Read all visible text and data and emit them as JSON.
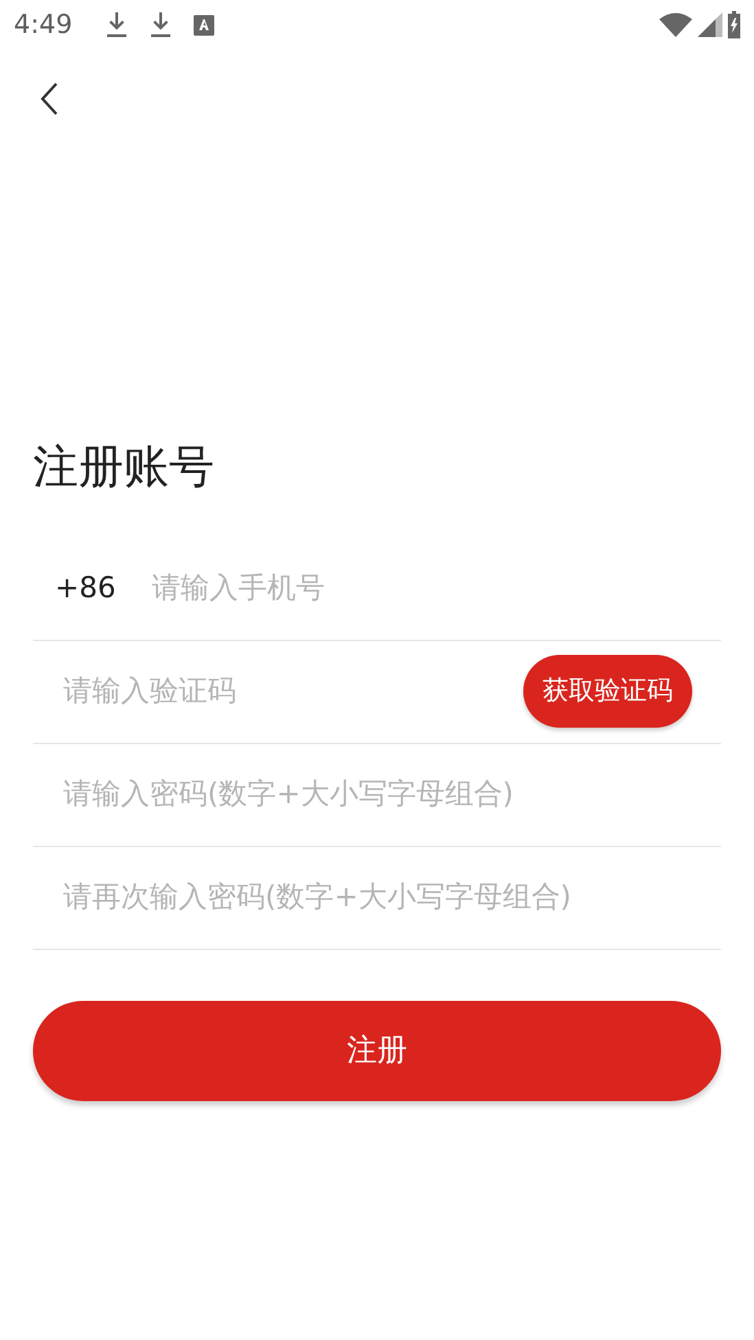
{
  "status_bar": {
    "time": "4:49"
  },
  "title": "注册账号",
  "phone": {
    "country_code": "+86",
    "placeholder": "请输入手机号"
  },
  "code": {
    "placeholder": "请输入验证码",
    "button": "获取验证码"
  },
  "passwords": [
    {
      "placeholder": "请输入密码(数字+大小写字母组合)"
    },
    {
      "placeholder": "请再次输入密码(数字+大小写字母组合)"
    }
  ],
  "submit": "注册"
}
